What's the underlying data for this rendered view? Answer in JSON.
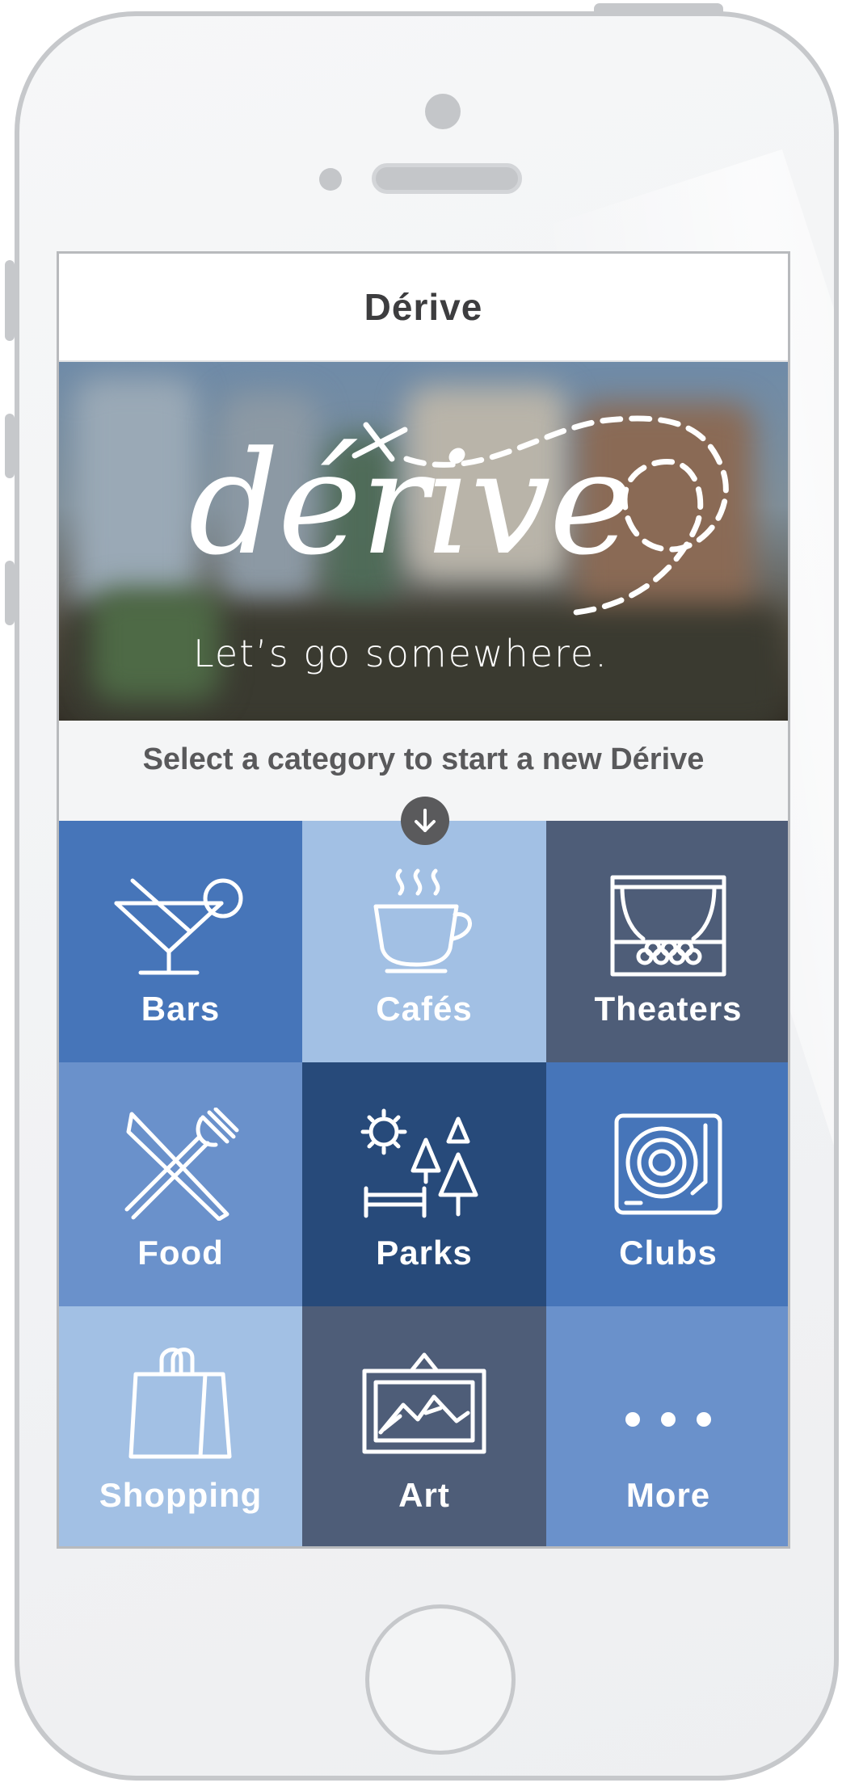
{
  "header": {
    "title": "Dérive"
  },
  "hero": {
    "logo_text": "dérive",
    "tagline": "Let’s go somewhere."
  },
  "prompt": {
    "text": "Select a category to start a new Dérive",
    "arrow_icon": "arrow-down-icon"
  },
  "categories": [
    {
      "label": "Bars",
      "icon": "martini-icon",
      "color": "#4675b9"
    },
    {
      "label": "Cafés",
      "icon": "coffee-cup-icon",
      "color": "#a2c0e4"
    },
    {
      "label": "Theaters",
      "icon": "theater-stage-icon",
      "color": "#4e5d78"
    },
    {
      "label": "Food",
      "icon": "knife-fork-icon",
      "color": "#6a91cb"
    },
    {
      "label": "Parks",
      "icon": "park-trees-icon",
      "color": "#274a7a"
    },
    {
      "label": "Clubs",
      "icon": "turntable-icon",
      "color": "#4675b9"
    },
    {
      "label": "Shopping",
      "icon": "shopping-bag-icon",
      "color": "#a2c0e4"
    },
    {
      "label": "Art",
      "icon": "framed-picture-icon",
      "color": "#4e5d78"
    },
    {
      "label": "More",
      "icon": "more-dots-icon",
      "color": "#6a91cb"
    }
  ]
}
